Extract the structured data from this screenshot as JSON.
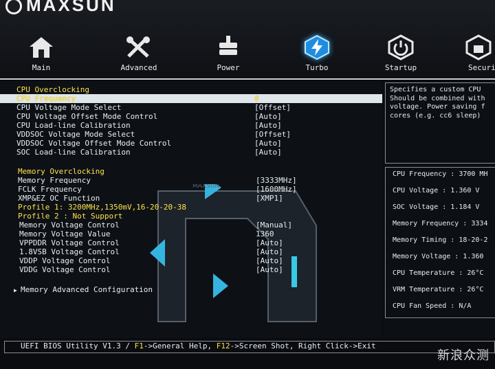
{
  "brand": {
    "name": "MAXSUN"
  },
  "tabs": [
    {
      "label": "Main",
      "icon": "home-icon"
    },
    {
      "label": "Advanced",
      "icon": "tools-icon"
    },
    {
      "label": "Power",
      "icon": "power-plug-icon"
    },
    {
      "label": "Turbo",
      "icon": "turbo-bolt-icon",
      "active": true
    },
    {
      "label": "Startup",
      "icon": "startup-power-icon"
    },
    {
      "label": "Securi",
      "icon": "security-icon"
    }
  ],
  "settings": [
    {
      "label": "CPU Overclocking",
      "value": "",
      "kind": "header"
    },
    {
      "label": "CPU Frequency",
      "value": "0",
      "kind": "selected"
    },
    {
      "label": "CPU Voltage Mode Select",
      "value": "[Offset]",
      "kind": "item"
    },
    {
      "label": "CPU Voltage Offset Mode Control",
      "value": "[Auto]",
      "kind": "item"
    },
    {
      "label": "CPU Load-line Calibration",
      "value": "[Auto]",
      "kind": "item"
    },
    {
      "label": "VDDSOC Voltage Mode Select",
      "value": "[Offset]",
      "kind": "item"
    },
    {
      "label": "VDDSOC Voltage Offset Mode Control",
      "value": "[Auto]",
      "kind": "item"
    },
    {
      "label": "SOC Load-line Calibration",
      "value": "[Auto]",
      "kind": "item"
    },
    {
      "label": "Memory Overclocking",
      "value": "",
      "kind": "header"
    },
    {
      "label": "Memory Frequency",
      "value": "[3333MHz]",
      "kind": "item"
    },
    {
      "label": "FCLK Frequency",
      "value": "[1600MHz]",
      "kind": "item"
    },
    {
      "label": "XMP&EZ OC Function",
      "value": "[XMP1]",
      "kind": "item"
    },
    {
      "label": "Profile 1: 3200MHz,1350mV,16-20-20-38",
      "value": "",
      "kind": "info"
    },
    {
      "label": "Profile 2 : Not Support",
      "value": "",
      "kind": "info"
    },
    {
      "label": "Memory Voltage Control",
      "value": "[Manual]",
      "kind": "item"
    },
    {
      "label": "Memory Voltage Value",
      "value": "1360",
      "kind": "item"
    },
    {
      "label": "VPPDDR Voltage Control",
      "value": "[Auto]",
      "kind": "item"
    },
    {
      "label": "1.8VSB Voltage Control",
      "value": "[Auto]",
      "kind": "item"
    },
    {
      "label": "VDDP Voltage Control",
      "value": "[Auto]",
      "kind": "item"
    },
    {
      "label": "VDDG Voltage Control",
      "value": "[Auto]",
      "kind": "item"
    },
    {
      "label": "Memory Advanced Configuration",
      "value": "",
      "kind": "submenu"
    }
  ],
  "help": {
    "text": "Specifies a custom CPU\nShould be combined with\nvoltage. Power saving f\ncores (e.g. cc6 sleep)"
  },
  "stats": [
    "CPU Frequency : 3700 MH",
    "CPU Voltage : 1.360 V",
    "SOC Voltage : 1.184 V",
    "Memory Frequency : 3334",
    "Memory Timing : 18-20-2",
    "Memory Voltage : 1.360",
    "CPU Temperature : 26°C",
    "VRM Temperature : 26°C",
    "CPU Fan Speed : N/A"
  ],
  "statusbar": {
    "version": "UEFI BIOS Utility V1.3 /",
    "f1_key": "F1",
    "f1_action": "->General Help,",
    "f12_key": "F12",
    "f12_action": "->Screen Shot, Right Click->Exit"
  },
  "watermark": "新浪众测",
  "colors": {
    "highlight": "#ffe24a",
    "accent": "#3fb8ff",
    "background": "#0d1116"
  }
}
